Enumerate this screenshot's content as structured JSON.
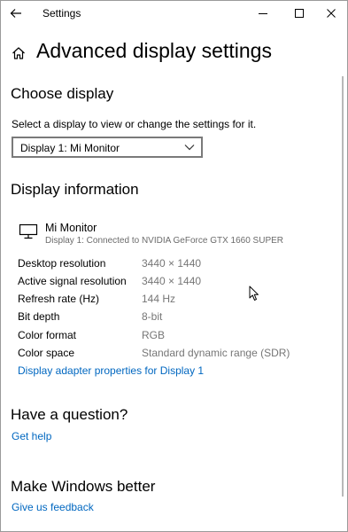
{
  "window": {
    "title": "Settings",
    "icons": {
      "back": "back-arrow-icon",
      "minimize": "minimize-icon",
      "maximize": "maximize-icon",
      "close": "close-icon"
    }
  },
  "page": {
    "title": "Advanced display settings",
    "icon": "home-icon"
  },
  "choose_display": {
    "heading": "Choose display",
    "instruction": "Select a display to view or change the settings for it.",
    "selected": "Display 1: Mi Monitor"
  },
  "display_info": {
    "heading": "Display information",
    "monitor_name": "Mi Monitor",
    "monitor_sub": "Display 1: Connected to NVIDIA GeForce GTX 1660 SUPER",
    "rows": [
      {
        "label": "Desktop resolution",
        "value": "3440 × 1440"
      },
      {
        "label": "Active signal resolution",
        "value": "3440 × 1440"
      },
      {
        "label": "Refresh rate (Hz)",
        "value": "144 Hz"
      },
      {
        "label": "Bit depth",
        "value": "8-bit"
      },
      {
        "label": "Color format",
        "value": "RGB"
      },
      {
        "label": "Color space",
        "value": "Standard dynamic range (SDR)"
      }
    ],
    "adapter_link": "Display adapter properties for Display 1"
  },
  "question": {
    "heading": "Have a question?",
    "link": "Get help"
  },
  "feedback": {
    "heading": "Make Windows better",
    "link": "Give us feedback"
  },
  "colors": {
    "link": "#0067c0",
    "muted": "#767676",
    "border": "#7a7a7a"
  }
}
